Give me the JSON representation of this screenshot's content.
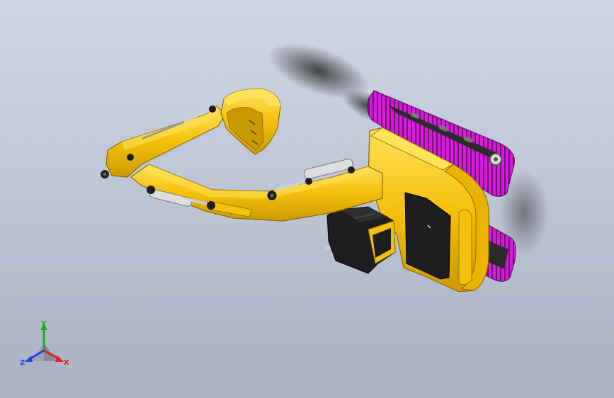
{
  "viewport": {
    "model": "excavator",
    "colors": {
      "body": "#f4c20d",
      "body_shade": "#c99a00",
      "body_highlight": "#ffe15a",
      "track": "#d21ed6",
      "track_dark": "#7a0c7c",
      "dark_parts": "#1e1e1e",
      "cylinder_rod": "#cfcfcf",
      "shadow": "#2a2a2a",
      "background_top": "#cfd5e3",
      "background_bottom": "#a9b1c2"
    }
  },
  "triad": {
    "y_label": "Y",
    "x_label": "X",
    "z_label": "Z",
    "colors": {
      "y": "#1fa81f",
      "x": "#e02020",
      "z": "#2040e0"
    }
  }
}
